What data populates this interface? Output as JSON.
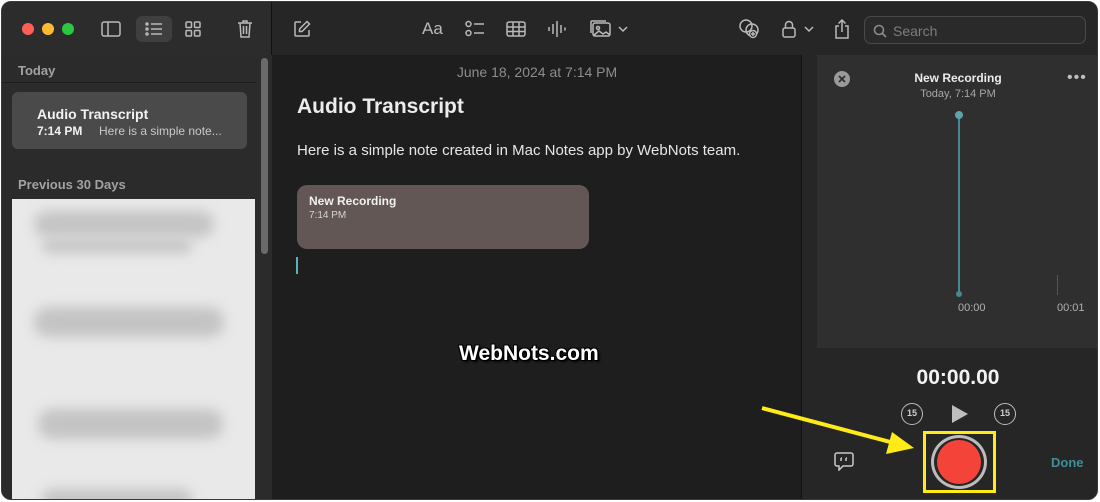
{
  "toolbar": {
    "search_placeholder": "Search",
    "format_label": "Aa"
  },
  "sidebar": {
    "section_today": "Today",
    "section_previous": "Previous 30 Days",
    "selected_note": {
      "title": "Audio Transcript",
      "time": "7:14 PM",
      "snippet": "Here is a simple note..."
    }
  },
  "editor": {
    "date": "June 18, 2024 at 7:14 PM",
    "title": "Audio Transcript",
    "body": "Here is a simple note created in Mac Notes app by WebNots team.",
    "attachment": {
      "name": "New Recording",
      "time": "7:14 PM"
    }
  },
  "recording_panel": {
    "name": "New Recording",
    "date": "Today, 7:14 PM",
    "more": "•••",
    "tick_start": "00:00",
    "tick_end": "00:01",
    "timer": "00:00.00",
    "skip_back": "15",
    "skip_forward": "15",
    "done_label": "Done"
  },
  "watermark": "WebNots.com",
  "colors": {
    "record": "#f4443a",
    "highlight": "#ffeb18",
    "accent": "#3f8f98"
  }
}
